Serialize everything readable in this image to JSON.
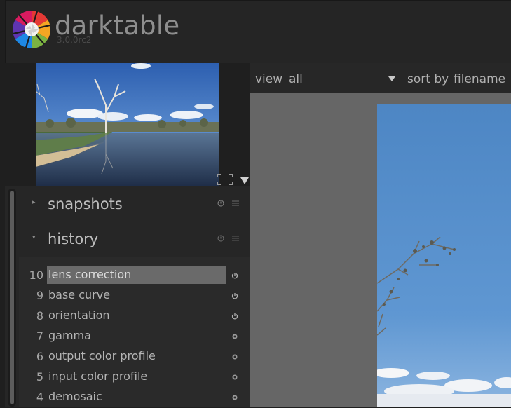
{
  "header": {
    "app_name": "darktable",
    "version": "3.0.0rc2",
    "logo_icon": "darktable-aperture-logo-icon"
  },
  "toolbar": {
    "view_label": "view",
    "view_value": "all",
    "sort_label": "sort by",
    "sort_value": "filename",
    "dropdown_icon": "triangle-down-icon"
  },
  "navigator": {
    "expand_icon": "expand-corners-icon",
    "collapse_icon": "triangle-down-icon"
  },
  "modules": [
    {
      "title": "snapshots",
      "expanded": false
    },
    {
      "title": "history",
      "expanded": true
    }
  ],
  "history": {
    "items": [
      {
        "num": "10",
        "label": "lens correction",
        "active": true,
        "icon": "power-icon"
      },
      {
        "num": "9",
        "label": "base curve",
        "active": false,
        "icon": "power-icon"
      },
      {
        "num": "8",
        "label": "orientation",
        "active": false,
        "icon": "power-icon"
      },
      {
        "num": "7",
        "label": "gamma",
        "active": false,
        "icon": "always-on-dot-icon"
      },
      {
        "num": "6",
        "label": "output color profile",
        "active": false,
        "icon": "always-on-dot-icon"
      },
      {
        "num": "5",
        "label": "input color profile",
        "active": false,
        "icon": "always-on-dot-icon"
      },
      {
        "num": "4",
        "label": "demosaic",
        "active": false,
        "icon": "always-on-dot-icon"
      }
    ]
  },
  "colors": {
    "background": "#1f1f1f",
    "panel": "#262626",
    "active_row": "#6a6a6a",
    "center_bg": "#666666"
  }
}
